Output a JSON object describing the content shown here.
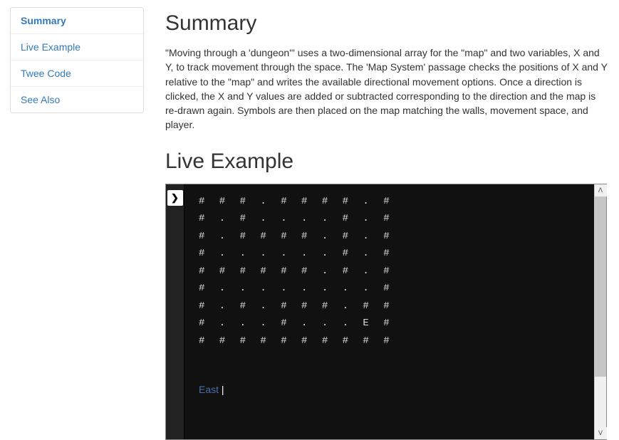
{
  "sidebar": {
    "items": [
      {
        "label": "Summary",
        "active": true
      },
      {
        "label": "Live Example",
        "active": false
      },
      {
        "label": "Twee Code",
        "active": false
      },
      {
        "label": "See Also",
        "active": false
      }
    ]
  },
  "main": {
    "summary_heading": "Summary",
    "summary_text": "\"Moving through a 'dungeon'\" uses a two-dimensional array for the \"map\" and two variables, X and Y, to track movement through the space. The 'Map System' passage checks the positions of X and Y relative to the \"map\" and writes the available directional movement options. Once a direction is clicked, the X and Y values are added or subtracted corresponding to the direction and the map is re-drawn again. Symbols are then placed on the map matching the walls, movement space, and player.",
    "live_heading": "Live Example"
  },
  "example": {
    "map_rows": [
      "# # # . # # # # . #",
      "# . # . . . . # . #",
      "# . # # # # . # . #",
      "# . . . . . . # . #",
      "# # # # # # . # . #",
      "# . . . . . . . . #",
      "# . # . # # # . # #",
      "# . . . # . . . E #",
      "# # # # # # # # # #"
    ],
    "direction_label": "East",
    "separator": "|"
  },
  "icons": {
    "expand": "❯",
    "up": "ᐱ",
    "down": "ᐯ"
  }
}
